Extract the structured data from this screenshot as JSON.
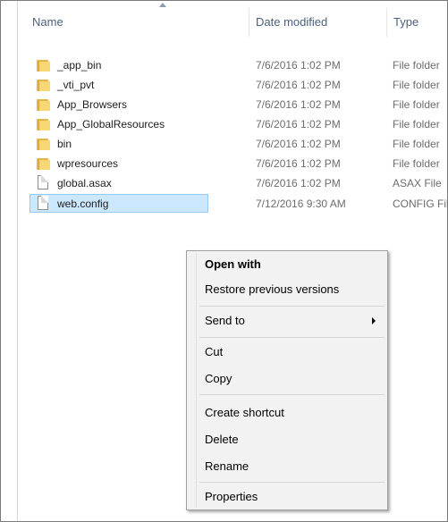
{
  "columns": {
    "name": "Name",
    "date_modified": "Date modified",
    "type": "Type"
  },
  "files": [
    {
      "icon": "folder-icon",
      "name": "_app_bin",
      "date": "7/6/2016 1:02 PM",
      "type": "File folder"
    },
    {
      "icon": "folder-icon",
      "name": "_vti_pvt",
      "date": "7/6/2016 1:02 PM",
      "type": "File folder"
    },
    {
      "icon": "folder-icon",
      "name": "App_Browsers",
      "date": "7/6/2016 1:02 PM",
      "type": "File folder"
    },
    {
      "icon": "folder-icon",
      "name": "App_GlobalResources",
      "date": "7/6/2016 1:02 PM",
      "type": "File folder"
    },
    {
      "icon": "folder-icon",
      "name": "bin",
      "date": "7/6/2016 1:02 PM",
      "type": "File folder"
    },
    {
      "icon": "folder-icon",
      "name": "wpresources",
      "date": "7/6/2016 1:02 PM",
      "type": "File folder"
    },
    {
      "icon": "file-icon",
      "name": "global.asax",
      "date": "7/6/2016 1:02 PM",
      "type": "ASAX File"
    },
    {
      "icon": "file-icon",
      "name": "web.config",
      "date": "7/12/2016 9:30 AM",
      "type": "CONFIG File",
      "selected": true
    }
  ],
  "context_menu": {
    "open_with": "Open with",
    "restore_previous_versions": "Restore previous versions",
    "send_to": "Send to",
    "cut": "Cut",
    "copy": "Copy",
    "create_shortcut": "Create shortcut",
    "delete": "Delete",
    "rename": "Rename",
    "properties": "Properties"
  },
  "colors": {
    "selection_fill": "#cce8ff",
    "selection_border": "#99c9ef",
    "folder": "#f8d775",
    "header_text": "#4c607a",
    "menu_background": "#f2f2f2"
  }
}
